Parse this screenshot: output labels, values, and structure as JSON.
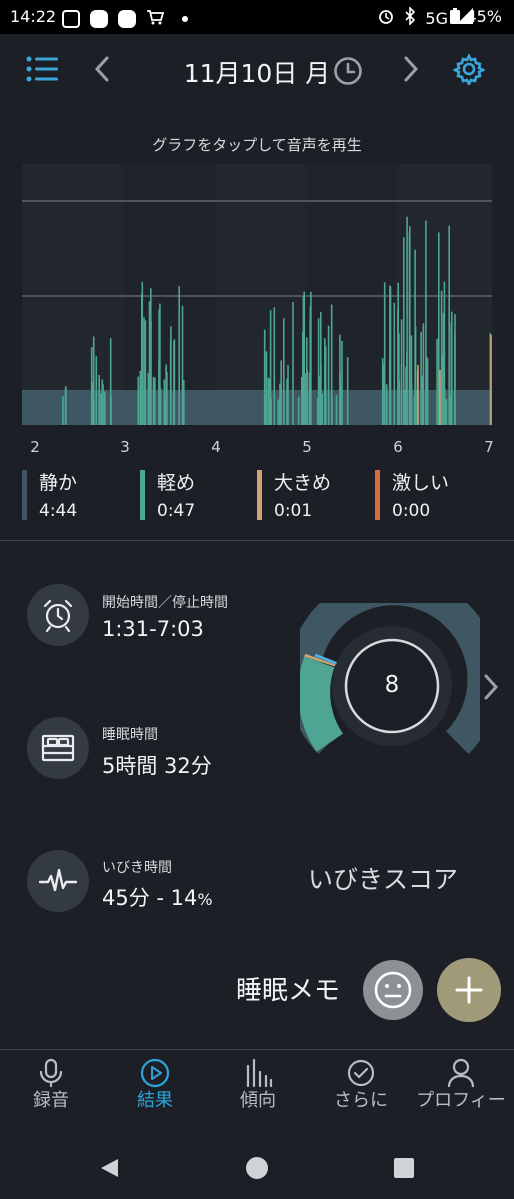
{
  "status_bar": {
    "time": "14:22",
    "network": "5G",
    "battery": "45%"
  },
  "header": {
    "date": "11月10日 月",
    "menu_icon": "list-menu-icon",
    "prev_icon": "chevron-left-icon",
    "history_icon": "clock-icon",
    "next_icon": "chevron-right-icon",
    "settings_icon": "gear-icon"
  },
  "chart": {
    "hint": "グラフをタップして音声を再生"
  },
  "chart_data": {
    "type": "bar",
    "x_ticks": [
      "2",
      "3",
      "4",
      "5",
      "6",
      "7"
    ],
    "legend": [
      {
        "label": "静か",
        "value": "4:44",
        "color": "#3e5762"
      },
      {
        "label": "軽め",
        "value": "0:47",
        "color": "#4fa593"
      },
      {
        "label": "大きめ",
        "value": "0:01",
        "color": "#cfa673"
      },
      {
        "label": "激しい",
        "value": "0:00",
        "color": "#d16e45"
      }
    ]
  },
  "stats": {
    "start_stop": {
      "label": "開始時間／停止時間",
      "value": "1:31-7:03",
      "icon": "alarm-clock-icon"
    },
    "sleep_time": {
      "label": "睡眠時間",
      "value": "5時間 32分",
      "icon": "bed-icon"
    },
    "snore_time": {
      "label": "いびき時間",
      "value": "45分 - 14",
      "percent_sign": "%",
      "icon": "waveform-icon"
    }
  },
  "score": {
    "value": 8,
    "title": "いびきスコア",
    "colors": {
      "quiet": "#3e5762",
      "light": "#4fa593",
      "loud": "#cfa673",
      "tick": "#4fb0e0"
    }
  },
  "memo": {
    "label": "睡眠メモ",
    "face_icon": "neutral-face-icon",
    "add_icon": "plus-icon"
  },
  "bottom_nav": {
    "items": [
      {
        "label": "録音",
        "icon": "microphone-icon"
      },
      {
        "label": "結果",
        "icon": "play-circle-icon"
      },
      {
        "label": "傾向",
        "icon": "bar-chart-icon"
      },
      {
        "label": "さらに",
        "icon": "check-circle-icon"
      },
      {
        "label": "プロフィー",
        "icon": "person-icon"
      }
    ],
    "active": "結果",
    "accent_color": "#2ea3d8"
  },
  "system_nav": {
    "back_icon": "triangle-back-icon",
    "home_icon": "circle-home-icon",
    "recents_icon": "square-recents-icon"
  }
}
